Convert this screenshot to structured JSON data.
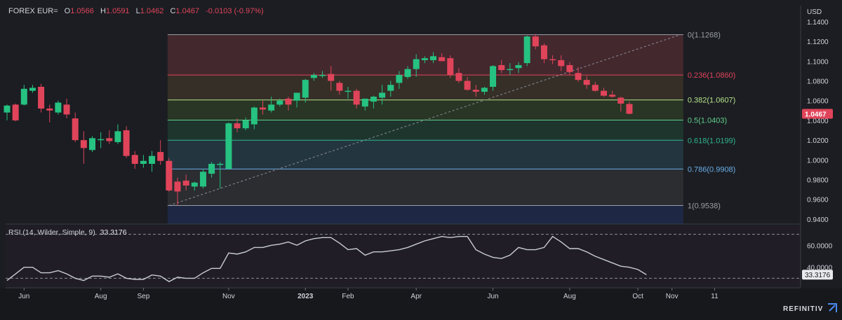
{
  "header": {
    "instrument": "FOREX EUR=",
    "open_label": "O",
    "open": "1.0566",
    "high_label": "H",
    "high": "1.0591",
    "low_label": "L",
    "low": "1.0462",
    "close_label": "C",
    "close": "1.0467",
    "change": "-0.0103 (-0.97%)",
    "currency": "USD"
  },
  "rsi_header": {
    "label": "RSI (14, Wilder, Simple, 9)",
    "value": "33.3176"
  },
  "brand": "REFINITIV",
  "colors": {
    "up": "#26c281",
    "down": "#e0445a",
    "rsi_line": "#c9ccd2",
    "background": "#1b1d22"
  },
  "chart_data": [
    {
      "type": "candlestick",
      "ylim": [
        0.935,
        1.152
      ],
      "price_axis_ticks": [
        "1.1400",
        "1.1200",
        "1.1000",
        "1.0800",
        "1.0600",
        "1.0400",
        "1.0200",
        "1.0000",
        "0.9800",
        "0.9600",
        "0.9400"
      ],
      "x_ticks": [
        {
          "label": "Jun",
          "week": 2
        },
        {
          "label": "Aug",
          "week": 11
        },
        {
          "label": "Sep",
          "week": 16
        },
        {
          "label": "Nov",
          "week": 26
        },
        {
          "label": "2023",
          "week": 35
        },
        {
          "label": "Feb",
          "week": 40
        },
        {
          "label": "Apr",
          "week": 48
        },
        {
          "label": "Jun",
          "week": 57
        },
        {
          "label": "Aug",
          "week": 66
        },
        {
          "label": "Oct",
          "week": 74
        },
        {
          "label": "Nov",
          "week": 78
        },
        {
          "label": "11",
          "week": 83
        }
      ],
      "last_price": "1.0467",
      "candles": [
        {
          "o": 1.048,
          "h": 1.056,
          "l": 1.04,
          "c": 1.055
        },
        {
          "o": 1.056,
          "h": 1.057,
          "l": 1.039,
          "c": 1.04
        },
        {
          "o": 1.056,
          "h": 1.076,
          "l": 1.055,
          "c": 1.072
        },
        {
          "o": 1.07,
          "h": 1.076,
          "l": 1.068,
          "c": 1.073
        },
        {
          "o": 1.074,
          "h": 1.077,
          "l": 1.048,
          "c": 1.052
        },
        {
          "o": 1.052,
          "h": 1.056,
          "l": 1.038,
          "c": 1.05
        },
        {
          "o": 1.048,
          "h": 1.06,
          "l": 1.046,
          "c": 1.058
        },
        {
          "o": 1.056,
          "h": 1.062,
          "l": 1.042,
          "c": 1.046
        },
        {
          "o": 1.042,
          "h": 1.048,
          "l": 1.018,
          "c": 1.02
        },
        {
          "o": 1.02,
          "h": 1.029,
          "l": 0.996,
          "c": 1.012
        },
        {
          "o": 1.01,
          "h": 1.024,
          "l": 1.008,
          "c": 1.022
        },
        {
          "o": 1.02,
          "h": 1.028,
          "l": 1.012,
          "c": 1.021
        },
        {
          "o": 1.022,
          "h": 1.03,
          "l": 1.016,
          "c": 1.019
        },
        {
          "o": 1.018,
          "h": 1.036,
          "l": 1.016,
          "c": 1.029
        },
        {
          "o": 1.03,
          "h": 1.034,
          "l": 1.002,
          "c": 1.004
        },
        {
          "o": 1.005,
          "h": 1.009,
          "l": 0.991,
          "c": 0.996
        },
        {
          "o": 0.996,
          "h": 1.005,
          "l": 0.992,
          "c": 0.999
        },
        {
          "o": 0.996,
          "h": 1.009,
          "l": 0.988,
          "c": 1.004
        },
        {
          "o": 1.008,
          "h": 1.02,
          "l": 0.995,
          "c": 0.999
        },
        {
          "o": 0.999,
          "h": 1.002,
          "l": 0.968,
          "c": 0.969
        },
        {
          "o": 0.978,
          "h": 0.982,
          "l": 0.954,
          "c": 0.968
        },
        {
          "o": 0.979,
          "h": 0.985,
          "l": 0.969,
          "c": 0.974
        },
        {
          "o": 0.973,
          "h": 0.978,
          "l": 0.969,
          "c": 0.977
        },
        {
          "o": 0.973,
          "h": 0.991,
          "l": 0.971,
          "c": 0.988
        },
        {
          "o": 0.986,
          "h": 0.998,
          "l": 0.982,
          "c": 0.996
        },
        {
          "o": 0.996,
          "h": 0.998,
          "l": 0.971,
          "c": 0.996
        },
        {
          "o": 0.991,
          "h": 1.038,
          "l": 0.99,
          "c": 1.037
        },
        {
          "o": 1.037,
          "h": 1.042,
          "l": 1.028,
          "c": 1.032
        },
        {
          "o": 1.032,
          "h": 1.043,
          "l": 1.03,
          "c": 1.04
        },
        {
          "o": 1.036,
          "h": 1.054,
          "l": 1.031,
          "c": 1.053
        },
        {
          "o": 1.053,
          "h": 1.06,
          "l": 1.046,
          "c": 1.051
        },
        {
          "o": 1.05,
          "h": 1.064,
          "l": 1.048,
          "c": 1.056
        },
        {
          "o": 1.056,
          "h": 1.062,
          "l": 1.054,
          "c": 1.06
        },
        {
          "o": 1.062,
          "h": 1.064,
          "l": 1.05,
          "c": 1.056
        },
        {
          "o": 1.06,
          "h": 1.068,
          "l": 1.053,
          "c": 1.068
        },
        {
          "o": 1.063,
          "h": 1.082,
          "l": 1.058,
          "c": 1.081
        },
        {
          "o": 1.083,
          "h": 1.088,
          "l": 1.08,
          "c": 1.086
        },
        {
          "o": 1.085,
          "h": 1.09,
          "l": 1.083,
          "c": 1.086
        },
        {
          "o": 1.087,
          "h": 1.095,
          "l": 1.07,
          "c": 1.08
        },
        {
          "o": 1.078,
          "h": 1.08,
          "l": 1.066,
          "c": 1.07
        },
        {
          "o": 1.069,
          "h": 1.074,
          "l": 1.062,
          "c": 1.07
        },
        {
          "o": 1.07,
          "h": 1.072,
          "l": 1.052,
          "c": 1.056
        },
        {
          "o": 1.054,
          "h": 1.062,
          "l": 1.05,
          "c": 1.062
        },
        {
          "o": 1.059,
          "h": 1.065,
          "l": 1.052,
          "c": 1.064
        },
        {
          "o": 1.063,
          "h": 1.076,
          "l": 1.056,
          "c": 1.068
        },
        {
          "o": 1.07,
          "h": 1.08,
          "l": 1.064,
          "c": 1.076
        },
        {
          "o": 1.078,
          "h": 1.09,
          "l": 1.072,
          "c": 1.086
        },
        {
          "o": 1.084,
          "h": 1.095,
          "l": 1.082,
          "c": 1.092
        },
        {
          "o": 1.092,
          "h": 1.107,
          "l": 1.084,
          "c": 1.102
        },
        {
          "o": 1.101,
          "h": 1.105,
          "l": 1.098,
          "c": 1.103
        },
        {
          "o": 1.101,
          "h": 1.109,
          "l": 1.098,
          "c": 1.105
        },
        {
          "o": 1.104,
          "h": 1.108,
          "l": 1.1,
          "c": 1.1
        },
        {
          "o": 1.103,
          "h": 1.106,
          "l": 1.083,
          "c": 1.086
        },
        {
          "o": 1.088,
          "h": 1.093,
          "l": 1.078,
          "c": 1.08
        },
        {
          "o": 1.08,
          "h": 1.084,
          "l": 1.07,
          "c": 1.071
        },
        {
          "o": 1.071,
          "h": 1.076,
          "l": 1.064,
          "c": 1.069
        },
        {
          "o": 1.069,
          "h": 1.074,
          "l": 1.066,
          "c": 1.073
        },
        {
          "o": 1.074,
          "h": 1.096,
          "l": 1.07,
          "c": 1.095
        },
        {
          "o": 1.096,
          "h": 1.101,
          "l": 1.088,
          "c": 1.091
        },
        {
          "o": 1.091,
          "h": 1.098,
          "l": 1.086,
          "c": 1.092
        },
        {
          "o": 1.093,
          "h": 1.099,
          "l": 1.088,
          "c": 1.096
        },
        {
          "o": 1.098,
          "h": 1.126,
          "l": 1.095,
          "c": 1.125
        },
        {
          "o": 1.125,
          "h": 1.1275,
          "l": 1.112,
          "c": 1.115
        },
        {
          "o": 1.116,
          "h": 1.118,
          "l": 1.098,
          "c": 1.102
        },
        {
          "o": 1.102,
          "h": 1.106,
          "l": 1.097,
          "c": 1.101
        },
        {
          "o": 1.101,
          "h": 1.106,
          "l": 1.09,
          "c": 1.095
        },
        {
          "o": 1.096,
          "h": 1.099,
          "l": 1.086,
          "c": 1.089
        },
        {
          "o": 1.088,
          "h": 1.094,
          "l": 1.079,
          "c": 1.081
        },
        {
          "o": 1.081,
          "h": 1.085,
          "l": 1.072,
          "c": 1.076
        },
        {
          "o": 1.076,
          "h": 1.079,
          "l": 1.069,
          "c": 1.07
        },
        {
          "o": 1.07,
          "h": 1.073,
          "l": 1.064,
          "c": 1.065
        },
        {
          "o": 1.066,
          "h": 1.07,
          "l": 1.063,
          "c": 1.064
        },
        {
          "o": 1.063,
          "h": 1.064,
          "l": 1.049,
          "c": 1.057
        },
        {
          "o": 1.0566,
          "h": 1.0591,
          "l": 1.0462,
          "c": 1.0467
        }
      ],
      "fibonacci": [
        {
          "label": "0(1.1268)",
          "value": 1.1268,
          "color": "#9a9ea6",
          "fill": "#4a2a30"
        },
        {
          "label": "0.236(1.0860)",
          "value": 1.086,
          "color": "#e0445a",
          "fill": "#3a3228"
        },
        {
          "label": "0.382(1.0607)",
          "value": 1.0607,
          "color": "#b5e38a",
          "fill": "#2b3a26"
        },
        {
          "label": "0.5(1.0403)",
          "value": 1.0403,
          "color": "#5fcf8a",
          "fill": "#1f3a30"
        },
        {
          "label": "0.618(1.0199)",
          "value": 1.0199,
          "color": "#2fb58e",
          "fill": "#243a44"
        },
        {
          "label": "0.786(0.9908)",
          "value": 0.9908,
          "color": "#6aaee8",
          "fill": "#2e3034"
        },
        {
          "label": "1(0.9538)",
          "value": 0.9538,
          "color": "#9a9ea6",
          "fill": "#1e2a4a"
        }
      ],
      "fib_start_week": 19,
      "fib_end_week": 79,
      "trendline": {
        "from": {
          "week": 19,
          "value": 0.9538
        },
        "to": {
          "week": 79,
          "value": 1.1268
        }
      }
    },
    {
      "type": "line",
      "title": "RSI (14, Wilder, Simple, 9)",
      "ylim": [
        22,
        78
      ],
      "ticks": [
        "60.0000",
        "40.0000"
      ],
      "bands": [
        70,
        30
      ],
      "last_value": "33.3176",
      "values": [
        28,
        34,
        40,
        40,
        35,
        35,
        37,
        34,
        30,
        28,
        32,
        32,
        31,
        34,
        30,
        29,
        29,
        33,
        32,
        27,
        31,
        30,
        30,
        35,
        39,
        39,
        53,
        52,
        54,
        58,
        58,
        60,
        61,
        63,
        60,
        64,
        66,
        67,
        67,
        62,
        56,
        57,
        51,
        54,
        54,
        55,
        56,
        58,
        61,
        64,
        66,
        68,
        67,
        68,
        68,
        56,
        52,
        49,
        48,
        51,
        58,
        56,
        56,
        58,
        68,
        63,
        57,
        57,
        54,
        50,
        47,
        44,
        41,
        40,
        38,
        33.3
      ]
    }
  ]
}
